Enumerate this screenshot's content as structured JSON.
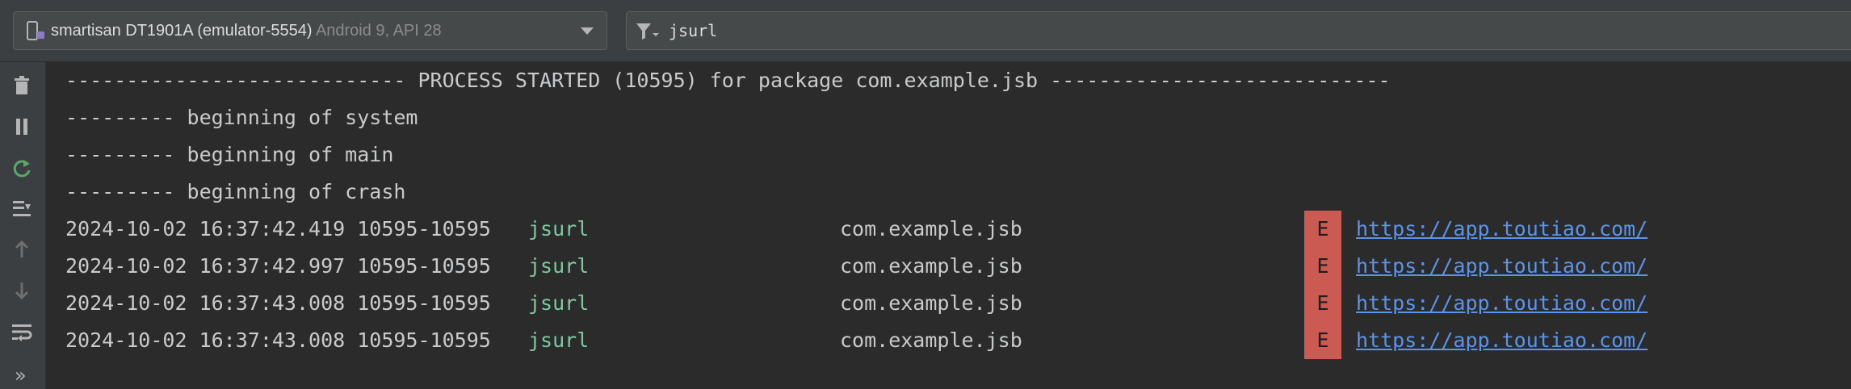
{
  "device": {
    "name": "smartisan DT1901A (emulator-5554)",
    "api": "Android 9, API 28"
  },
  "filter": {
    "value": "jsurl"
  },
  "side_toolbar": {
    "more_label": "»"
  },
  "log": {
    "header_lines": [
      "---------------------------- PROCESS STARTED (10595) for package com.example.jsb ----------------------------",
      "--------- beginning of system",
      "--------- beginning of main",
      "--------- beginning of crash"
    ],
    "entries": [
      {
        "timestamp": "2024-10-02 16:37:42.419 10595-10595",
        "tag": "jsurl",
        "package": "com.example.jsb",
        "level": "E",
        "message": "https://app.toutiao.com/"
      },
      {
        "timestamp": "2024-10-02 16:37:42.997 10595-10595",
        "tag": "jsurl",
        "package": "com.example.jsb",
        "level": "E",
        "message": "https://app.toutiao.com/"
      },
      {
        "timestamp": "2024-10-02 16:37:43.008 10595-10595",
        "tag": "jsurl",
        "package": "com.example.jsb",
        "level": "E",
        "message": "https://app.toutiao.com/"
      },
      {
        "timestamp": "2024-10-02 16:37:43.008 10595-10595",
        "tag": "jsurl",
        "package": "com.example.jsb",
        "level": "E",
        "message": "https://app.toutiao.com/"
      }
    ]
  },
  "colors": {
    "tag": "#7ec8a0",
    "error_level_bg": "#cb5a52",
    "link": "#5c94ea",
    "restart_icon": "#59a869"
  }
}
